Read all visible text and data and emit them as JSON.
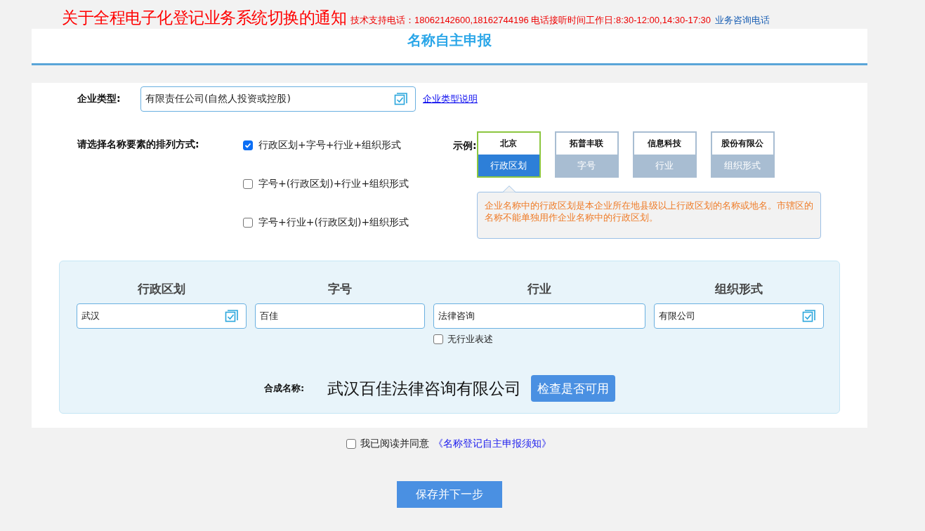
{
  "notice": {
    "title": "关于全程电子化登记业务系统切换的通知",
    "support": "技术支持电话：18062142600,18162744196 电话接听时间工作日:8:30-12:00,14:30-17:30",
    "consult_link": "业务咨询电话"
  },
  "header": {
    "title": "名称自主申报"
  },
  "company_type": {
    "label": "企业类型:",
    "value": "有限责任公司(自然人投资或控股)",
    "link": "企业类型说明"
  },
  "arrangement": {
    "label": "请选择名称要素的排列方式:",
    "options": [
      {
        "label": "行政区划+字号+行业+组织形式",
        "checked": true
      },
      {
        "label": "字号+(行政区划)+行业+组织形式",
        "checked": false
      },
      {
        "label": "字号+行业+(行政区划)+组织形式",
        "checked": false
      }
    ]
  },
  "example": {
    "label": "示例:",
    "cards": [
      {
        "sample": "北京",
        "label": "行政区划",
        "selected": true
      },
      {
        "sample": "拓普丰联",
        "label": "字号",
        "selected": false
      },
      {
        "sample": "信息科技",
        "label": "行业",
        "selected": false
      },
      {
        "sample": "股份有限公",
        "label": "组织形式",
        "selected": false
      }
    ],
    "tooltip": "企业名称中的行政区划是本企业所在地县级以上行政区划的名称或地名。市辖区的名称不能单独用作企业名称中的行政区划。"
  },
  "name_parts": {
    "fields": [
      {
        "label": "行政区划",
        "value": "武汉",
        "kind": "picker"
      },
      {
        "label": "字号",
        "value": "百佳",
        "kind": "text"
      },
      {
        "label": "行业",
        "value": "法律咨询",
        "kind": "text"
      },
      {
        "label": "组织形式",
        "value": "有限公司",
        "kind": "picker"
      }
    ],
    "no_industry": {
      "label": "无行业表述",
      "checked": false
    }
  },
  "composed": {
    "label": "合成名称:",
    "value": "武汉百佳法律咨询有限公司",
    "button": "检查是否可用"
  },
  "agreement": {
    "checked": false,
    "text": "我已阅读并同意",
    "link": "《名称登记自主申报须知》"
  },
  "save_button": "保存并下一步"
}
